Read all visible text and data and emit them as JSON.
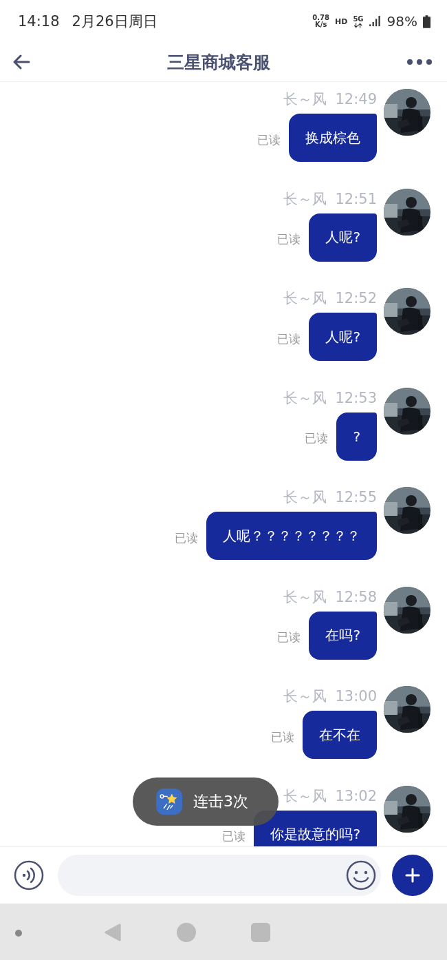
{
  "status_bar": {
    "time": "14:18",
    "date": "2月26日周日",
    "speed_value": "0.78",
    "speed_unit": "K/s",
    "hd": "HD",
    "network": "5G",
    "battery": "98%"
  },
  "header": {
    "title": "三星商城客服"
  },
  "messages": [
    {
      "sender": "长～风",
      "time": "12:49",
      "read": "已读",
      "text": "换成棕色"
    },
    {
      "sender": "长～风",
      "time": "12:51",
      "read": "已读",
      "text": "人呢?"
    },
    {
      "sender": "长～风",
      "time": "12:52",
      "read": "已读",
      "text": "人呢?"
    },
    {
      "sender": "长～风",
      "time": "12:53",
      "read": "已读",
      "text": "?"
    },
    {
      "sender": "长～风",
      "time": "12:55",
      "read": "已读",
      "text": "人呢？？？？？？？？"
    },
    {
      "sender": "长～风",
      "time": "12:58",
      "read": "已读",
      "text": "在吗?"
    },
    {
      "sender": "长～风",
      "time": "13:00",
      "read": "已读",
      "text": "在不在"
    },
    {
      "sender": "长～风",
      "time": "13:02",
      "read": "已读",
      "text": "你是故意的吗?"
    }
  ],
  "toast": {
    "text": "连击3次"
  }
}
